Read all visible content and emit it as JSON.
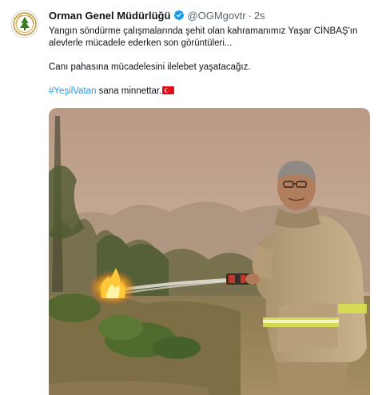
{
  "tweet": {
    "author": {
      "display_name": "Orman Genel Müdürlüğü",
      "handle": "@OGMgovtr",
      "separator": "·",
      "time": "2s",
      "verified_icon": "verified-badge-icon",
      "avatar_icon": "ogm-emblem-logo"
    },
    "text": {
      "line1": "Yangın söndürme çalışmalarında şehit olan kahramanımız Yaşar CİNBAŞ'ın alevlerle mücadele ederken son görüntüleri...",
      "line2": "Canı pahasına mücadelesini ilelebet yaşatacağız.",
      "hashtag": "#YeşilVatan",
      "line3_rest": " sana minnettar.",
      "flag_icon": "turkey-flag-icon"
    },
    "media": {
      "type": "photo",
      "description_icon": "firefighter-photo"
    },
    "colors": {
      "link": "#1d9bf0",
      "secondary_text": "#536471",
      "primary_text": "#0f1419",
      "verified": "#1d9bf0",
      "flag_red": "#e30a17"
    }
  }
}
